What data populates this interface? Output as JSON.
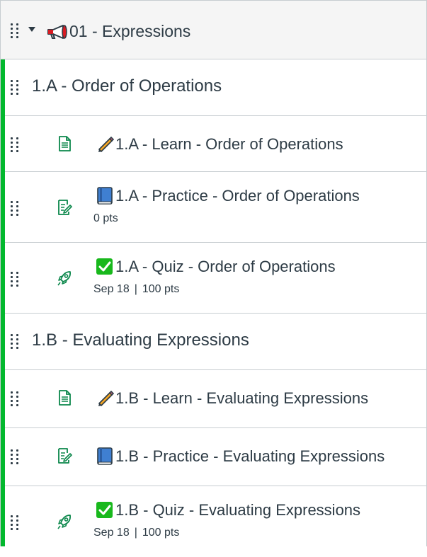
{
  "module": {
    "title": "01 - Expressions",
    "icon": "megaphone-icon"
  },
  "sections": [
    {
      "title": "1.A - Order of Operations",
      "items": [
        {
          "type": "page",
          "icon": "document-icon",
          "emoji": "pencil-icon",
          "title": "1.A - Learn - Order of Operations"
        },
        {
          "type": "assignment",
          "icon": "assignment-icon",
          "emoji": "book-icon",
          "title": "1.A - Practice - Order of Operations",
          "points": "0 pts"
        },
        {
          "type": "quiz",
          "icon": "rocket-icon",
          "emoji": "check-icon",
          "title": "1.A - Quiz - Order of Operations",
          "due": "Sep 18",
          "separator": "|",
          "points": "100 pts"
        }
      ]
    },
    {
      "title": "1.B - Evaluating Expressions",
      "items": [
        {
          "type": "page",
          "icon": "document-icon",
          "emoji": "pencil-icon",
          "title": "1.B - Learn - Evaluating Expressions"
        },
        {
          "type": "assignment",
          "icon": "assignment-icon",
          "emoji": "book-icon",
          "title": "1.B - Practice - Evaluating Expressions"
        },
        {
          "type": "quiz",
          "icon": "rocket-icon",
          "emoji": "check-icon",
          "title": "1.B - Quiz - Evaluating Expressions",
          "due": "Sep 18",
          "separator": "|",
          "points": "100 pts"
        }
      ]
    }
  ],
  "colors": {
    "accent_green": "#03b82e",
    "icon_green": "#0b874b",
    "text": "#2d3b45",
    "border": "#c7cdd1",
    "header_bg": "#f5f5f5"
  }
}
